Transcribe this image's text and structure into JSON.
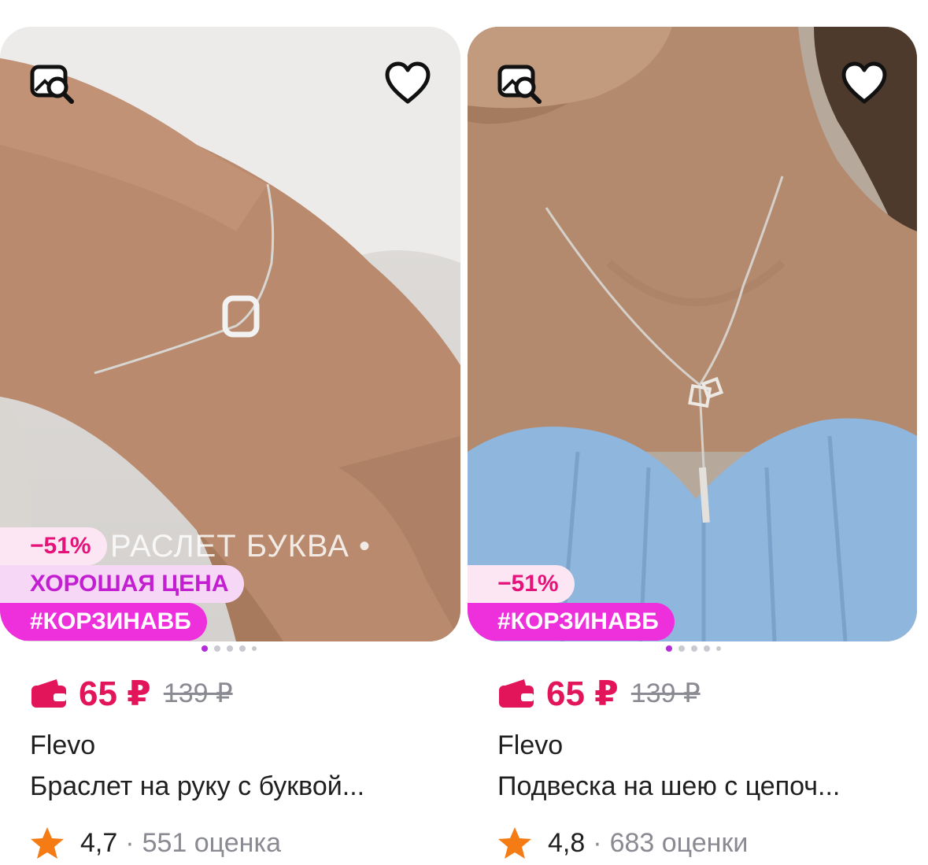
{
  "products": [
    {
      "overlay_text": "РАСЛЕТ БУКВА •",
      "badges": {
        "discount": "−51%",
        "good_price": "ХОРОШАЯ ЦЕНА",
        "tag": "#КОРЗИНАВБ"
      },
      "price": "65 ₽",
      "old_price": "139 ₽",
      "brand": "Flevo",
      "title": "Браслет на руку с буквой...",
      "rating": "4,7",
      "separator": "·",
      "reviews": "551 оценка",
      "image_icons": [
        "image-search-icon",
        "heart-icon"
      ]
    },
    {
      "badges": {
        "discount": "−51%",
        "tag": "#КОРЗИНАВБ"
      },
      "price": "65 ₽",
      "old_price": "139 ₽",
      "brand": "Flevo",
      "title": "Подвеска на шею с цепоч...",
      "rating": "4,8",
      "separator": "·",
      "reviews": "683 оценки",
      "image_icons": [
        "image-search-icon",
        "heart-icon"
      ]
    }
  ],
  "colors": {
    "price": "#e3155a",
    "discount_badge_bg": "#fde6f3",
    "good_price_badge_bg": "#f7d7f6",
    "tag_badge_bg": "#ee2fdc",
    "star": "#f57c14",
    "active_dot": "#b52cd8"
  }
}
